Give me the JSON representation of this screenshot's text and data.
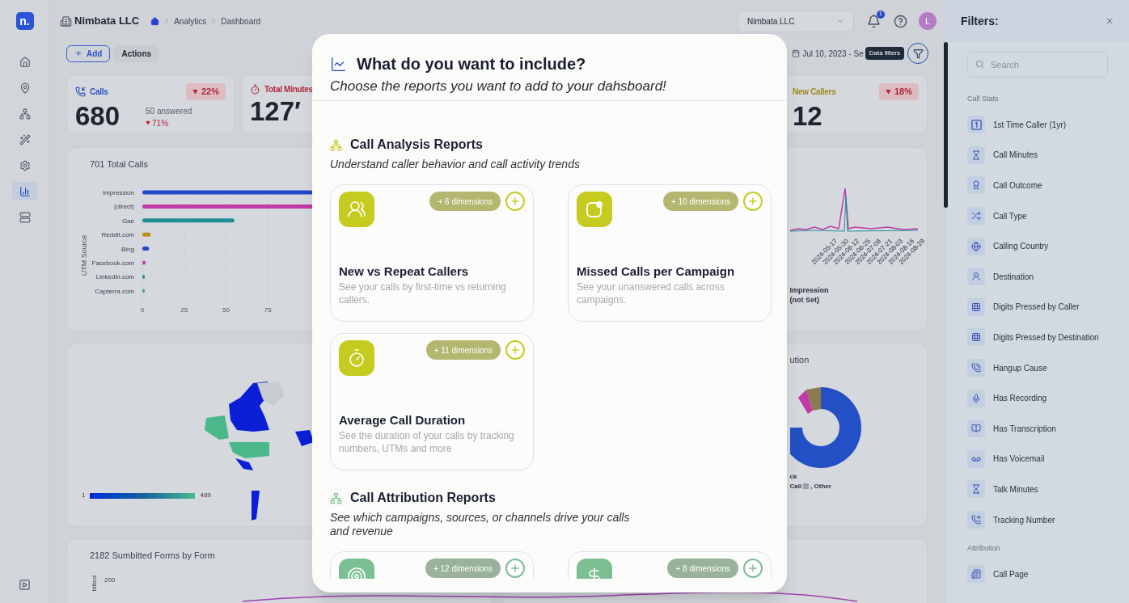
{
  "header": {
    "logo": "n.",
    "company": "Nimbata LLC",
    "breadcrumb": [
      "Analytics",
      "Dashboard"
    ],
    "account_select": "Nimbata LLC",
    "notification_count": "1",
    "avatar": "L"
  },
  "sidebar": {
    "items": [
      {
        "selected": false
      },
      {
        "selected": false
      },
      {
        "selected": false
      },
      {
        "selected": false
      },
      {
        "selected": false
      },
      {
        "selected": true
      },
      {
        "selected": false
      }
    ]
  },
  "toolbar": {
    "add_button": "Add",
    "actions_button": "Actions",
    "date_range": "Jul 10, 2023 - Se",
    "tooltip": "Data filters"
  },
  "stats": [
    {
      "label": "Calls",
      "value": "680",
      "change": "22%",
      "sub": "50 answered",
      "sub_change": "71%",
      "color": "#2c4fc0"
    },
    {
      "label": "Total Minutes",
      "value": "127′",
      "color": "#b0283e"
    },
    {
      "label": "New Callers",
      "value": "12",
      "change": "18%",
      "color": "#a08a1f"
    }
  ],
  "calls_chart": {
    "title": "701 Total Calls",
    "ylabel": "UTM Source",
    "categories": [
      "Impression",
      "(direct)",
      "Gae",
      "Reddit.com",
      "Bing",
      "Facebook.com",
      "Linkedin.com",
      "Capterra.com"
    ],
    "xticks": [
      "0",
      "25",
      "50",
      "75"
    ]
  },
  "trend_chart": {
    "x_labels": [
      "2024-05-17",
      "2024-05-30",
      "2024-06-12",
      "2024-06-25",
      "2024-07-08",
      "2024-07-21",
      "2024-08-03",
      "2024-08-16",
      "2024-08-29"
    ],
    "legend": [
      "Impression",
      "(not Set)"
    ]
  },
  "map": {
    "legend_min": "1",
    "legend_max": "489"
  },
  "donut": {
    "title": "ution",
    "legend": [
      "ck",
      "Call",
      ", Other"
    ]
  },
  "forms_chart": {
    "title": "2182 Sumbitted Forms by Form",
    "ytick": "200",
    "ylabel": "bitted"
  },
  "modal": {
    "title": "What do you want to include?",
    "subtitle": "Choose the reports you want to add to your dahsboard!",
    "sections": [
      {
        "title": "Call Analysis Reports",
        "subtitle": "Understand caller behavior and call activity trends",
        "color": "#c5cc1f",
        "cards": [
          {
            "dimensions": "+ 6 dimensions",
            "title": "New vs Repeat Callers",
            "description": "See your calls by first-time vs returning callers."
          },
          {
            "dimensions": "+ 10 dimensions",
            "title": "Missed Calls per Campaign",
            "description": "See your unanswered calls across campaigns."
          },
          {
            "dimensions": "+ 11 dimensions",
            "title": "Average Call Duration",
            "description": "See the duration of your calls by tracking numbers, UTMs and more"
          }
        ]
      },
      {
        "title": "Call Attribution Reports",
        "subtitle": "See which campaigns, sources, or channels drive your calls and revenue",
        "color": "#7cbf93",
        "cards": [
          {
            "dimensions": "+ 12 dimensions"
          },
          {
            "dimensions": "+ 8 dimensions"
          }
        ]
      }
    ]
  },
  "filters": {
    "title": "Filters:",
    "search_placeholder": "Search",
    "groups": [
      {
        "label": "Call Stats",
        "items": [
          "1st Time Caller (1yr)",
          "Call Minutes",
          "Call Outcome",
          "Call Type",
          "Calling Country",
          "Destination",
          "Digits Pressed by Caller",
          "Digits Pressed by Destination",
          "Hangup Cause",
          "Has Recording",
          "Has Transcription",
          "Has Voicemail",
          "Talk Minutes",
          "Tracking Number"
        ]
      },
      {
        "label": "Attribution",
        "items": [
          "Call Page"
        ]
      }
    ]
  }
}
